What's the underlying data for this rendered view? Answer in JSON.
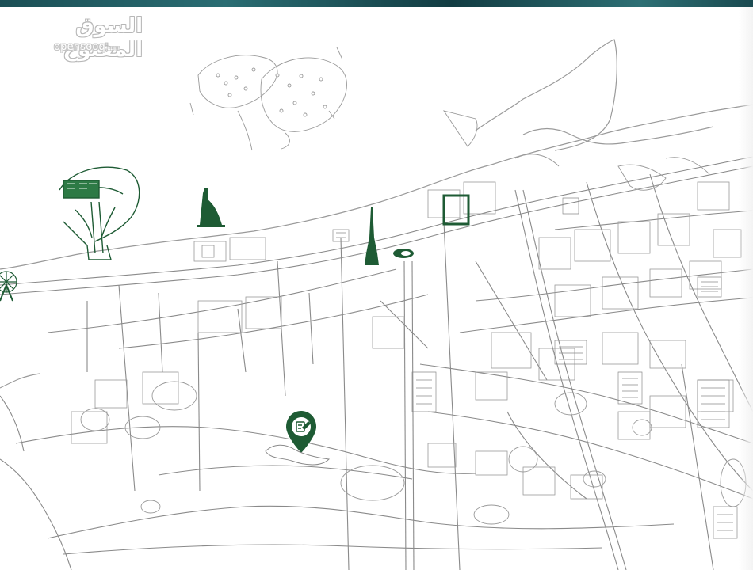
{
  "logo": {
    "arabic": "السوق المفتوح",
    "latin": "opensooq",
    "domain": ".com"
  },
  "map": {
    "road_color": "#8a8a8a",
    "landmark_color": "#1e5b34",
    "pin_color": "#1e5b34",
    "pin_icon": "edit-document-icon",
    "landmarks": [
      "palm-atlantis-icon",
      "burj-al-arab-icon",
      "burj-khalifa-icon",
      "dubai-opera-icon",
      "dubai-frame-icon",
      "ain-dubai-icon"
    ]
  }
}
